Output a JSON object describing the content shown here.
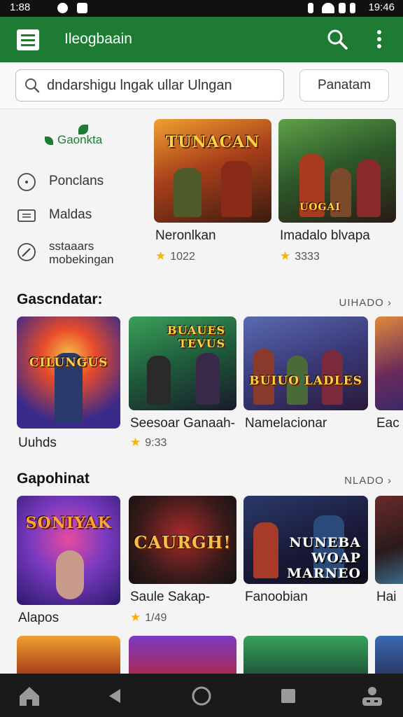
{
  "status": {
    "time_left": "1:88",
    "time_right": "19:46"
  },
  "appbar": {
    "title": "Ileogbaain",
    "menu_icon": "hamburger-menu-icon",
    "search_icon": "search-icon",
    "more_icon": "more-vert-icon",
    "color": "#1e7b34"
  },
  "search": {
    "value": "dndarshigu lngak ullar Ulngan",
    "filter_label": "Panatam"
  },
  "sidebar": {
    "logo": "Gaonkta",
    "items": [
      {
        "label": "Ponclans",
        "icon": "circle-dot-icon"
      },
      {
        "label": "Maldas",
        "icon": "ticket-icon"
      },
      {
        "label": "sstaaars mobekingan",
        "icon": "pencil-icon"
      }
    ]
  },
  "featured": [
    {
      "title": "Neronlkan",
      "rating": "1022",
      "art": "TUNACAN"
    },
    {
      "title": "Imadalo blvapa",
      "rating": "3333",
      "art": "UOGAI"
    }
  ],
  "sections": [
    {
      "title": "Gascndatar:",
      "more": "UIHADO ›",
      "cards": [
        {
          "title": "Uuhds",
          "rating": "",
          "art": "CILUNGUS"
        },
        {
          "title": "Seesoar Ganaah-",
          "rating": "9:33",
          "art": "BUAUES TEVUS"
        },
        {
          "title": "Namelacionar",
          "rating": "",
          "art": "BUIUO LADLES"
        },
        {
          "title": "Eac",
          "rating": "",
          "art": ""
        }
      ]
    },
    {
      "title": "Gapohinat",
      "more": "NLADO ›",
      "cards": [
        {
          "title": "Alapos",
          "rating": "",
          "art": "SONIYAK"
        },
        {
          "title": "Saule Sakap-",
          "rating": "1/49",
          "art": "CAURGH!"
        },
        {
          "title": "Fanoobian",
          "rating": "",
          "art": "NUNEBA WOAP MARNEO"
        },
        {
          "title": "Hai",
          "rating": "",
          "art": ""
        }
      ]
    }
  ],
  "bottom_nav": [
    "home-icon",
    "back-icon",
    "circle-home-icon",
    "square-recents-icon",
    "profile-icon"
  ]
}
